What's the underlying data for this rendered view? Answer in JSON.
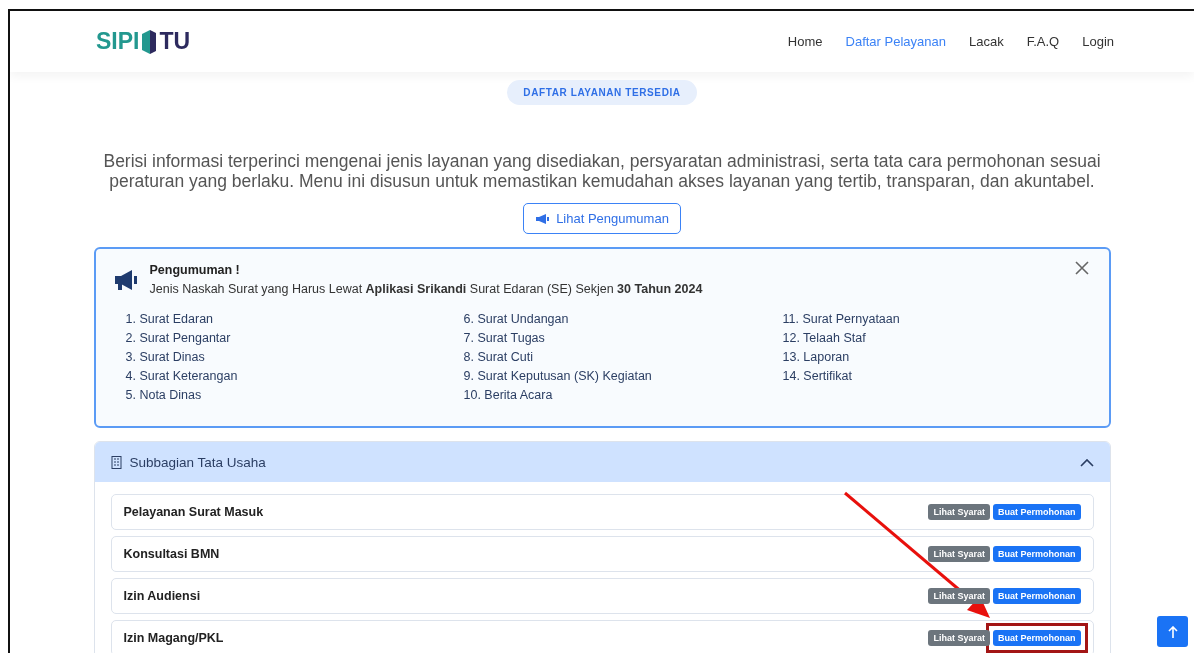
{
  "navbar": {
    "logo_left": "SIPI",
    "logo_right": "TU",
    "links": [
      {
        "label": "Home",
        "selected": false
      },
      {
        "label": "Daftar Pelayanan",
        "selected": true
      },
      {
        "label": "Lacak",
        "selected": false
      },
      {
        "label": "F.A.Q",
        "selected": false
      },
      {
        "label": "Login",
        "selected": false
      }
    ]
  },
  "badge": "DAFTAR LAYANAN TERSEDIA",
  "intro": "Berisi informasi terperinci mengenai jenis layanan yang disediakan, persyaratan administrasi, serta tata cara permohonan sesuai peraturan yang berlaku. Menu ini disusun untuk memastikan kemudahan akses layanan yang tertib, transparan, dan akuntabel.",
  "announcement_button": "Lihat Pengumuman",
  "announcement": {
    "title": "Pengumuman !",
    "message": "Jenis Naskah Surat yang Harus Lewat **Aplikasi Srikandi** Surat Edaran (SE) Sekjen **30 Tahun 2024**",
    "columns": [
      [
        "1. Surat Edaran",
        "2. Surat Pengantar",
        "3. Surat Dinas",
        "4. Surat Keterangan",
        "5. Nota Dinas"
      ],
      [
        "6. Surat Undangan",
        "7. Surat Tugas",
        "8. Surat Cuti",
        "9. Surat Keputusan (SK) Kegiatan",
        "10. Berita Acara"
      ],
      [
        "11. Surat Pernyataan",
        "12. Telaah Staf",
        "13. Laporan",
        "14. Sertifikat"
      ]
    ]
  },
  "section": {
    "title": "Subbagian Tata Usaha",
    "expanded": true,
    "services": [
      {
        "name": "Pelayanan Surat Masuk",
        "secondary": "Lihat Syarat",
        "primary": "Buat Permohonan",
        "highlighted": false
      },
      {
        "name": "Konsultasi BMN",
        "secondary": "Lihat Syarat",
        "primary": "Buat Permohonan",
        "highlighted": false
      },
      {
        "name": "Izin Audiensi",
        "secondary": "Lihat Syarat",
        "primary": "Buat Permohonan",
        "highlighted": false
      },
      {
        "name": "Izin Magang/PKL",
        "secondary": "Lihat Syarat",
        "primary": "Buat Permohonan",
        "highlighted": true
      }
    ]
  },
  "pointer_arrow": true
}
